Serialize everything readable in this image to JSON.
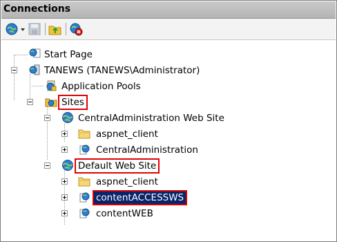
{
  "panel": {
    "title": "Connections"
  },
  "toolbar": {
    "icons": [
      "connect-globe-icon",
      "dropdown-arrow-icon",
      "save-icon",
      "folder-up-icon",
      "disconnect-icon"
    ]
  },
  "tree": {
    "start_page": "Start Page",
    "server": "TANEWS (TANEWS\\Administrator)",
    "app_pools": "Application Pools",
    "sites": "Sites",
    "central_site": "CentralAdministration Web Site",
    "central_aspnet": "aspnet_client",
    "central_app": "CentralAdministration",
    "default_site": "Default Web Site",
    "default_aspnet": "aspnet_client",
    "content_access": "contentACCESSWS",
    "content_web": "contentWEB"
  },
  "colors": {
    "highlight": "#e00000",
    "selection": "#0a246a"
  }
}
